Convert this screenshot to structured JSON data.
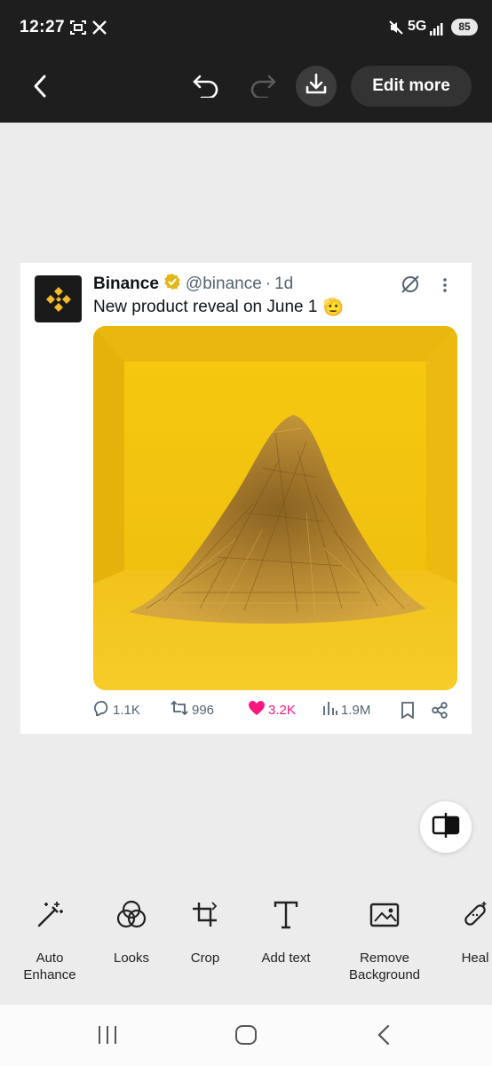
{
  "status_bar": {
    "time": "12:27",
    "network": "5G",
    "battery": "85"
  },
  "toolbar": {
    "edit_more": "Edit more",
    "icons": [
      "back-icon",
      "undo-icon",
      "redo-icon",
      "download-icon"
    ]
  },
  "tweet": {
    "name": "Binance",
    "handle": "@binance",
    "separator": "·",
    "time": "1d",
    "text": "New product reveal on June 1",
    "emoji": "🫡",
    "replies": "1.1K",
    "retweets": "996",
    "likes": "3.2K",
    "views": "1.9M",
    "colors": {
      "like": "#f91880",
      "image_bg": "#f3c51b",
      "hay": "#b98a30"
    }
  },
  "tools": [
    {
      "label": "Auto\nEnhance",
      "icon": "magic-wand-icon"
    },
    {
      "label": "Looks",
      "icon": "looks-icon"
    },
    {
      "label": "Crop",
      "icon": "crop-icon"
    },
    {
      "label": "Add text",
      "icon": "text-icon"
    },
    {
      "label": "Remove\nBackground",
      "icon": "remove-background-icon"
    },
    {
      "label": "Heal",
      "icon": "heal-icon"
    }
  ]
}
